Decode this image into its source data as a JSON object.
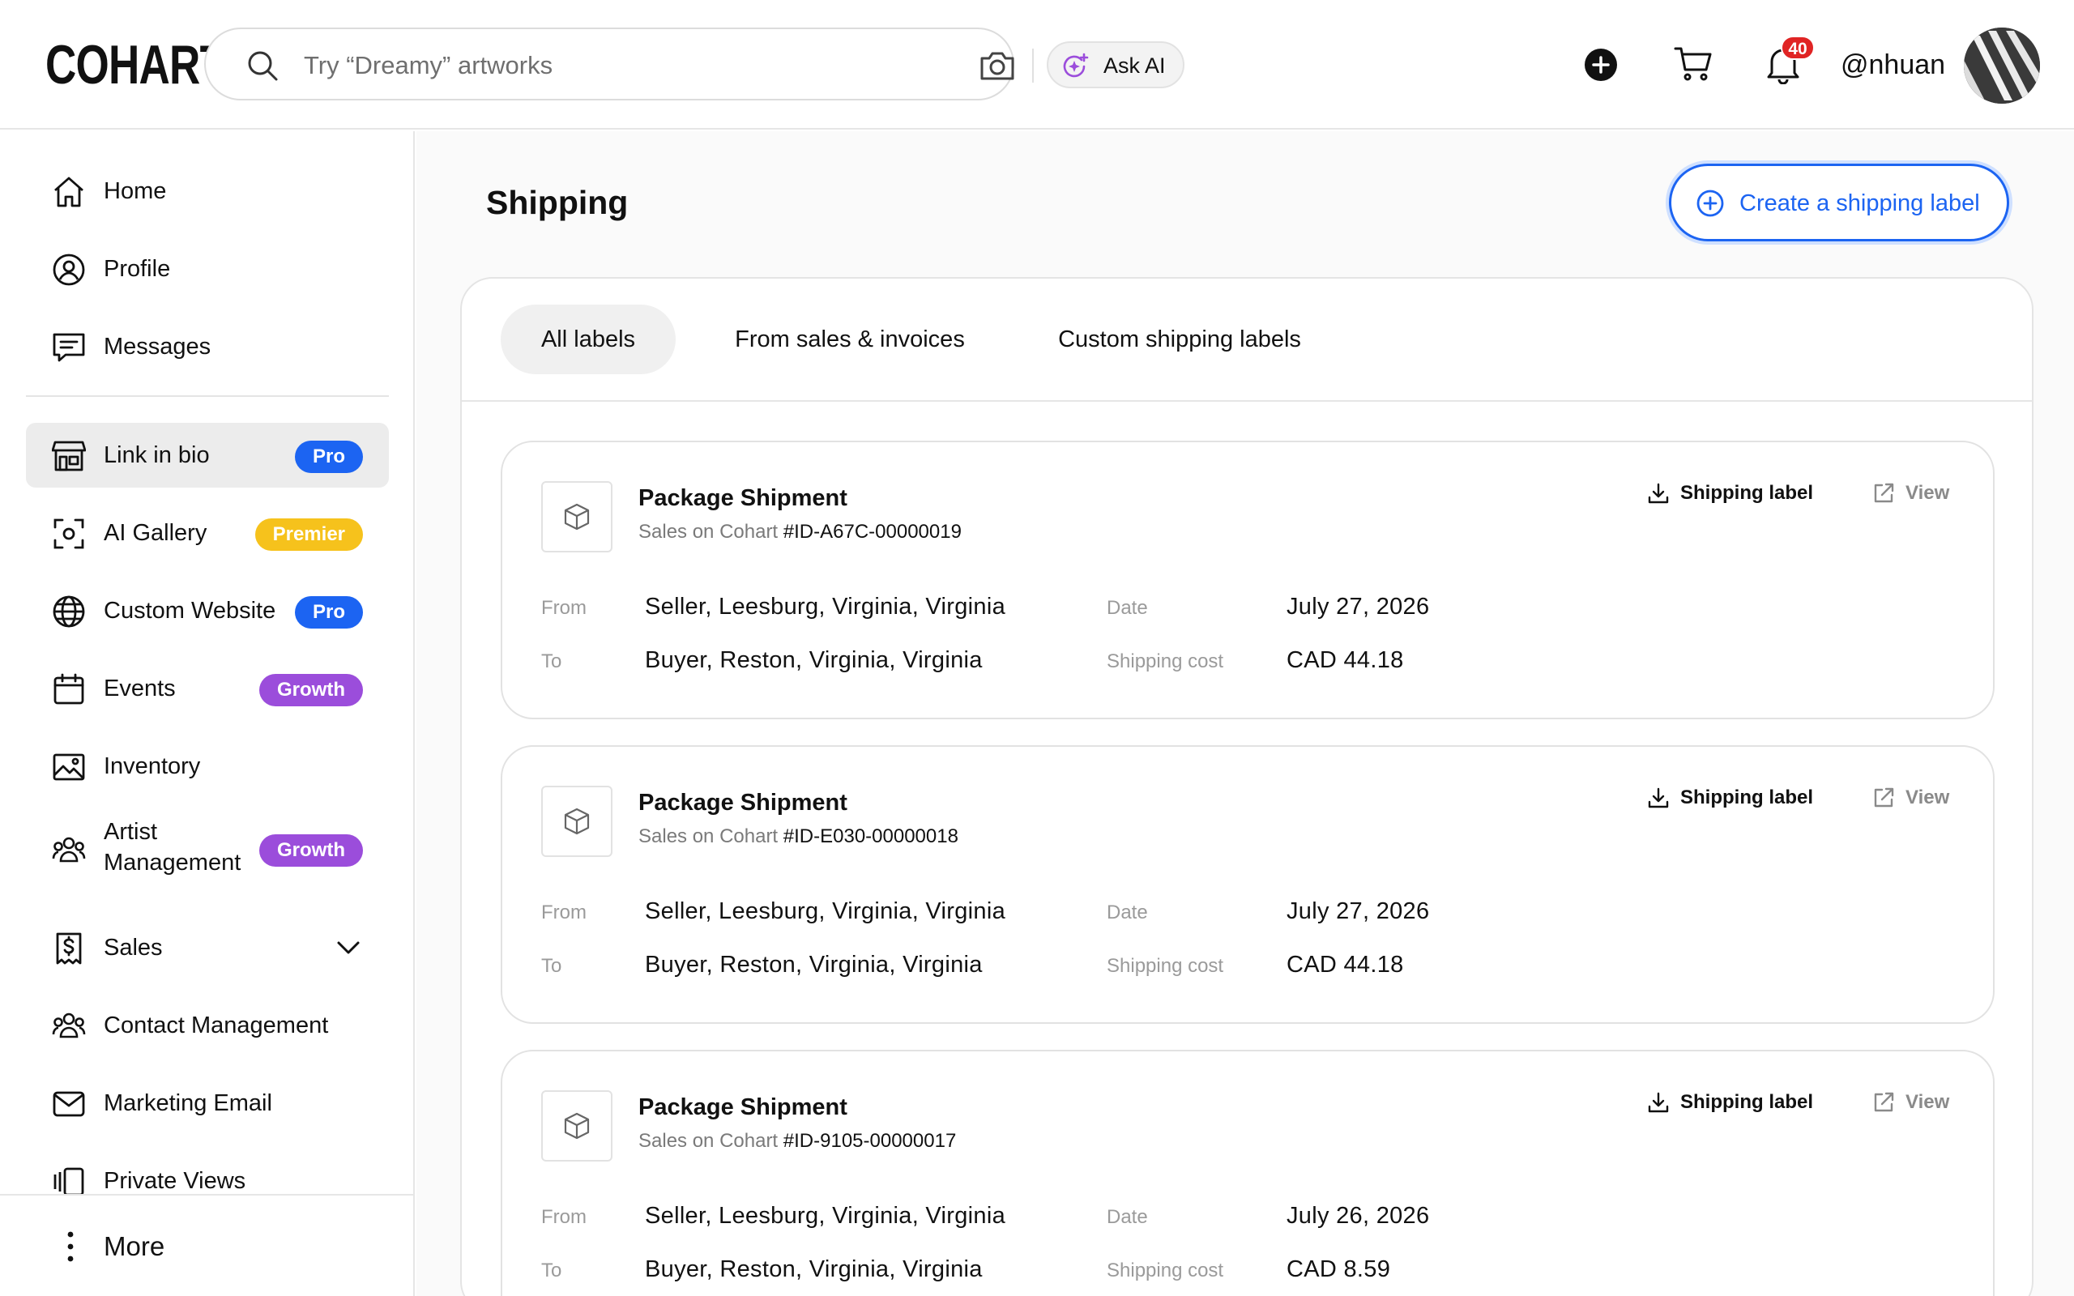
{
  "app": {
    "logo": "COHART"
  },
  "search": {
    "placeholder": "Try “Dreamy” artworks",
    "ask_ai_label": "Ask AI"
  },
  "header": {
    "notification_count": "40",
    "username": "@nhuan"
  },
  "sidebar": {
    "items": [
      {
        "label": "Home",
        "icon": "home-icon"
      },
      {
        "label": "Profile",
        "icon": "user-circle-icon"
      },
      {
        "label": "Messages",
        "icon": "chat-icon"
      },
      {
        "label": "Link in bio",
        "icon": "storefront-icon",
        "badge": "Pro"
      },
      {
        "label": "AI Gallery",
        "icon": "ai-scan-icon",
        "badge": "Premier"
      },
      {
        "label": "Custom Website",
        "icon": "globe-icon",
        "badge": "Pro"
      },
      {
        "label": "Events",
        "icon": "calendar-icon",
        "badge": "Growth"
      },
      {
        "label": "Inventory",
        "icon": "image-icon"
      },
      {
        "label": "Artist Management",
        "icon": "people-icon",
        "badge": "Growth"
      },
      {
        "label": "Sales",
        "icon": "dollar-doc-icon"
      },
      {
        "label": "Contact Management",
        "icon": "contacts-icon"
      },
      {
        "label": "Marketing Email",
        "icon": "mail-icon"
      },
      {
        "label": "Private Views",
        "icon": "private-views-icon"
      }
    ],
    "more_label": "More"
  },
  "main": {
    "title": "Shipping",
    "create_label": "Create a shipping label",
    "tabs": [
      "All labels",
      "From sales & invoices",
      "Custom shipping labels"
    ],
    "active_tab": "All labels",
    "field_labels": {
      "from": "From",
      "to": "To",
      "date": "Date",
      "cost": "Shipping cost"
    },
    "action_labels": {
      "download": "Shipping label",
      "view": "View"
    },
    "shipments": [
      {
        "title": "Package Shipment",
        "source": "Sales on Cohart",
        "id": "#ID-A67C-00000019",
        "from": "Seller, Leesburg, Virginia, Virginia",
        "to": "Buyer, Reston, Virginia, Virginia",
        "date": "July 27, 2026",
        "cost": "CAD 44.18"
      },
      {
        "title": "Package Shipment",
        "source": "Sales on Cohart",
        "id": "#ID-E030-00000018",
        "from": "Seller, Leesburg, Virginia, Virginia",
        "to": "Buyer, Reston, Virginia, Virginia",
        "date": "July 27, 2026",
        "cost": "CAD 44.18"
      },
      {
        "title": "Package Shipment",
        "source": "Sales on Cohart",
        "id": "#ID-9105-00000017",
        "from": "Seller, Leesburg, Virginia, Virginia",
        "to": "Buyer, Reston, Virginia, Virginia",
        "date": "July 26, 2026",
        "cost": "CAD 8.59"
      }
    ]
  },
  "colors": {
    "accent": "#1c64f2",
    "pro": "#1c64f2",
    "premier": "#f6c21c",
    "growth": "#9b4ddb",
    "badge": "#e02424"
  }
}
